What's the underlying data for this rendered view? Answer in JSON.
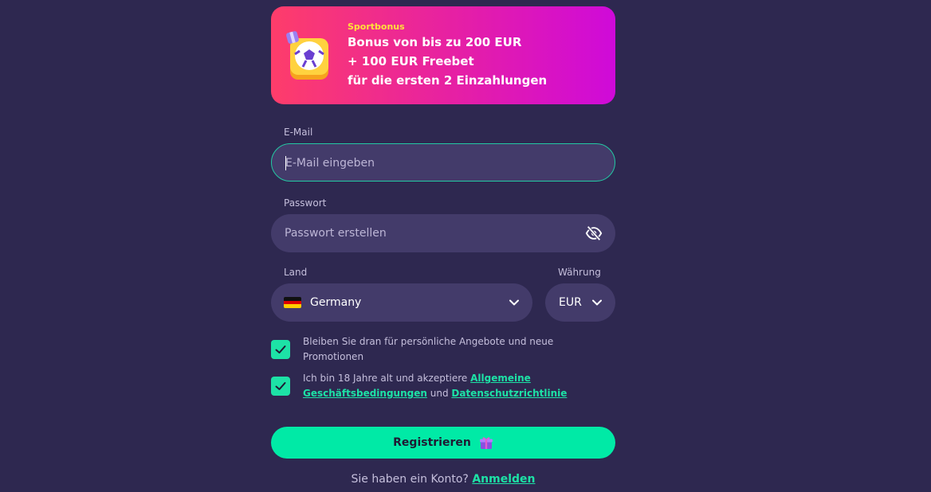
{
  "banner": {
    "tag": "Sportbonus",
    "line1": "Bonus von bis zu 200 EUR",
    "line2": "+ 100 EUR Freebet",
    "line3": "für die ersten 2 Einzahlungen",
    "art_icon": "soccer-ball-gift-icon"
  },
  "email": {
    "label": "E-Mail",
    "placeholder": "E-Mail eingeben",
    "value": ""
  },
  "password": {
    "label": "Passwort",
    "placeholder": "Passwort erstellen",
    "value": "",
    "toggle_icon": "eye-slash-icon"
  },
  "country": {
    "label": "Land",
    "value": "Germany",
    "flag_icon": "germany-flag-icon"
  },
  "currency": {
    "label": "Währung",
    "value": "EUR"
  },
  "consents": [
    {
      "checked": true,
      "text": "Bleiben Sie dran für persönliche Angebote und neue Promotionen"
    },
    {
      "checked": true,
      "text_before": "Ich bin 18 Jahre alt und akzeptiere",
      "terms_link": "Allgemeine Geschäftsbedingungen",
      "joiner": "und",
      "privacy_link": "Datenschutzrichtlinie"
    }
  ],
  "register_button": {
    "label": "Registrieren",
    "icon": "gift-icon"
  },
  "footer": {
    "question": "Sie haben ein Konto?",
    "login_link": "Anmelden"
  },
  "colors": {
    "background": "#2e2850",
    "field": "#433b6a",
    "accent": "#00eaa6",
    "banner_start": "#fe3d6a",
    "banner_end": "#cf0ad9",
    "tag": "#ffe03a"
  }
}
